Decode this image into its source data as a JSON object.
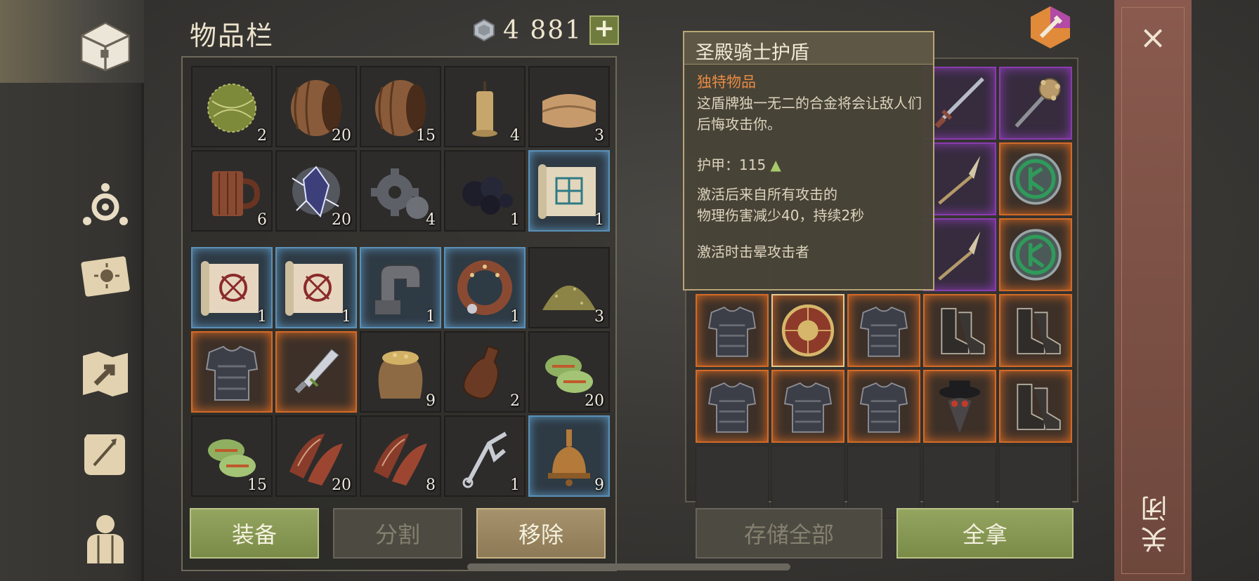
{
  "header": {
    "title": "物品栏",
    "currency_amount": "4  881",
    "plus_label": "+"
  },
  "inventory_top": [
    {
      "icon": "hay-bundle-icon",
      "count": "2",
      "rarity": "none"
    },
    {
      "icon": "barrel-icon",
      "count": "20",
      "rarity": "none"
    },
    {
      "icon": "barrel-icon",
      "count": "15",
      "rarity": "none"
    },
    {
      "icon": "candle-icon",
      "count": "4",
      "rarity": "none"
    },
    {
      "icon": "cloth-icon",
      "count": "3",
      "rarity": "none"
    },
    {
      "icon": "mug-icon",
      "count": "6",
      "rarity": "none"
    },
    {
      "icon": "crystal-icon",
      "count": "20",
      "rarity": "none"
    },
    {
      "icon": "gear-icon",
      "count": "4",
      "rarity": "none"
    },
    {
      "icon": "coal-icon",
      "count": "1",
      "rarity": "none"
    },
    {
      "icon": "blueprint-scroll-icon",
      "count": "1",
      "rarity": "blue"
    }
  ],
  "inventory_bottom": [
    {
      "icon": "recipe-scroll-icon",
      "count": "1",
      "rarity": "blue"
    },
    {
      "icon": "recipe-scroll-icon",
      "count": "1",
      "rarity": "blue"
    },
    {
      "icon": "iron-bracket-icon",
      "count": "1",
      "rarity": "blue"
    },
    {
      "icon": "leather-collar-icon",
      "count": "1",
      "rarity": "blue"
    },
    {
      "icon": "powder-pile-icon",
      "count": "3",
      "rarity": "none"
    },
    {
      "icon": "chain-armor-icon",
      "count": "",
      "rarity": "orange"
    },
    {
      "icon": "dagger-icon",
      "count": "",
      "rarity": "orange"
    },
    {
      "icon": "grain-sack-icon",
      "count": "9",
      "rarity": "none"
    },
    {
      "icon": "bottle-icon",
      "count": "2",
      "rarity": "none"
    },
    {
      "icon": "herb-bundle-icon",
      "count": "20",
      "rarity": "none"
    },
    {
      "icon": "herb-bundle-icon",
      "count": "15",
      "rarity": "none"
    },
    {
      "icon": "meat-strips-icon",
      "count": "20",
      "rarity": "none"
    },
    {
      "icon": "meat-strips-icon",
      "count": "8",
      "rarity": "none"
    },
    {
      "icon": "tongs-icon",
      "count": "1",
      "rarity": "none"
    },
    {
      "icon": "bell-icon",
      "count": "9",
      "rarity": "blue"
    }
  ],
  "buttons": {
    "equip": "装备",
    "split": "分割",
    "remove": "移除",
    "store_all": "存储全部",
    "take_all": "全拿",
    "close": "关闭",
    "close_x": "×"
  },
  "tooltip": {
    "title": "圣殿骑士护盾",
    "rarity_label": "独特物品",
    "description": "这盾牌独一无二的合金将会让敌人们后悔攻击你。",
    "armor_label": "护甲：115",
    "armor_arrow": "▲",
    "effect_line1": "激活后来自所有攻击的",
    "effect_line2": "物理伤害减少40，持续2秒",
    "effect_line3": "激活时击晕攻击者"
  },
  "stash": [
    {
      "icon": "",
      "rarity": "hidden"
    },
    {
      "icon": "",
      "rarity": "hidden"
    },
    {
      "icon": "",
      "rarity": "hidden"
    },
    {
      "icon": "longsword-icon",
      "rarity": "purple"
    },
    {
      "icon": "mace-icon",
      "rarity": "purple"
    },
    {
      "icon": "",
      "rarity": "hidden"
    },
    {
      "icon": "",
      "rarity": "hidden"
    },
    {
      "icon": "",
      "rarity": "hidden"
    },
    {
      "icon": "spear-icon",
      "rarity": "purple"
    },
    {
      "icon": "rune-shield-icon",
      "rarity": "orange"
    },
    {
      "icon": "",
      "rarity": "hidden"
    },
    {
      "icon": "",
      "rarity": "hidden"
    },
    {
      "icon": "",
      "rarity": "hidden"
    },
    {
      "icon": "spear-icon",
      "rarity": "purple"
    },
    {
      "icon": "rune-shield-icon",
      "rarity": "orange"
    },
    {
      "icon": "chain-armor-icon",
      "rarity": "orange"
    },
    {
      "icon": "templar-shield-icon",
      "rarity": "selected"
    },
    {
      "icon": "chain-armor-icon",
      "rarity": "orange"
    },
    {
      "icon": "boots-icon",
      "rarity": "orange"
    },
    {
      "icon": "boots-icon",
      "rarity": "orange"
    },
    {
      "icon": "chain-armor-icon",
      "rarity": "orange"
    },
    {
      "icon": "chain-armor-icon",
      "rarity": "orange"
    },
    {
      "icon": "chain-armor-icon",
      "rarity": "orange"
    },
    {
      "icon": "plague-mask-icon",
      "rarity": "orange"
    },
    {
      "icon": "boots-icon",
      "rarity": "orange"
    },
    {
      "icon": "",
      "rarity": "empty"
    },
    {
      "icon": "",
      "rarity": "empty"
    },
    {
      "icon": "",
      "rarity": "empty"
    },
    {
      "icon": "",
      "rarity": "empty"
    },
    {
      "icon": "",
      "rarity": "empty"
    }
  ],
  "colors": {
    "orange": "#d46a26",
    "blue": "#5a90b8",
    "purple": "#8a3cb0",
    "green_button": "#7a8b48"
  }
}
